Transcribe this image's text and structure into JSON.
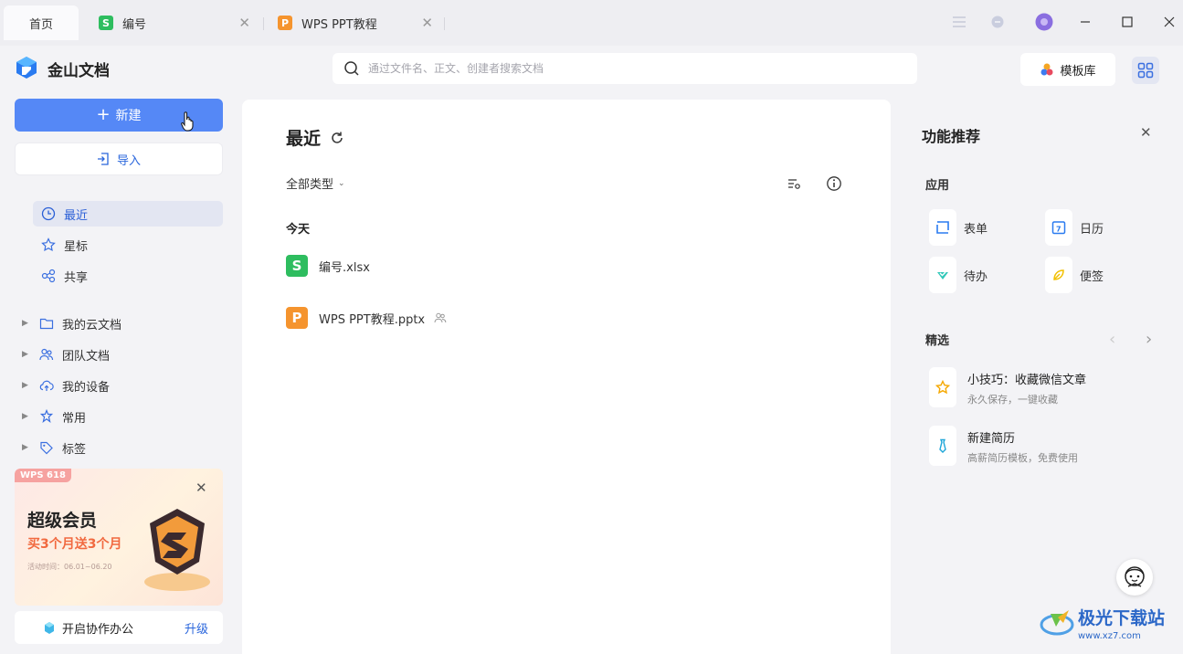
{
  "tabs": {
    "home": "首页",
    "tab1": {
      "label": "编号",
      "icon": "S",
      "color": "#2ebd5f"
    },
    "tab2": {
      "label": "WPS PPT教程",
      "icon": "P",
      "color": "#f5942e"
    }
  },
  "header": {
    "app_name": "金山文档",
    "search_placeholder": "通过文件名、正文、创建者搜索文档",
    "template_label": "模板库"
  },
  "sidebar": {
    "new_label": "新建",
    "import_label": "导入",
    "nav": [
      {
        "label": "最近",
        "icon": "clock-icon"
      },
      {
        "label": "星标",
        "icon": "star-icon"
      },
      {
        "label": "共享",
        "icon": "share-icon"
      }
    ],
    "tree": [
      {
        "label": "我的云文档",
        "icon": "folder-icon"
      },
      {
        "label": "团队文档",
        "icon": "team-icon"
      },
      {
        "label": "我的设备",
        "icon": "cloud-upload-icon"
      },
      {
        "label": "常用",
        "icon": "pin-icon"
      },
      {
        "label": "标签",
        "icon": "tag-icon"
      }
    ],
    "promo": {
      "badge": "WPS 618",
      "title": "超级会员",
      "subtitle": "买3个月送3个月",
      "time": "活动时间：06.01~06.20"
    },
    "collab_label": "开启协作办公",
    "upgrade_label": "升级"
  },
  "main": {
    "title": "最近",
    "filter_label": "全部类型",
    "group_today": "今天",
    "files": [
      {
        "name": "编号.xlsx",
        "icon": "S",
        "color": "#2ebd5f",
        "shared": false
      },
      {
        "name": "WPS PPT教程.pptx",
        "icon": "P",
        "color": "#f5942e",
        "shared": true
      }
    ]
  },
  "right_panel": {
    "title": "功能推荐",
    "apps_label": "应用",
    "apps": [
      {
        "label": "表单",
        "icon": "form-icon"
      },
      {
        "label": "日历",
        "icon": "calendar-icon"
      },
      {
        "label": "待办",
        "icon": "todo-icon"
      },
      {
        "label": "便签",
        "icon": "note-icon"
      }
    ],
    "featured_label": "精选",
    "featured": [
      {
        "title": "小技巧：收藏微信文章",
        "subtitle": "永久保存，一键收藏"
      },
      {
        "title": "新建简历",
        "subtitle": "高薪简历模板，免费使用"
      }
    ]
  },
  "watermark": {
    "text": "极光下载站",
    "url": "www.xz7.com"
  }
}
